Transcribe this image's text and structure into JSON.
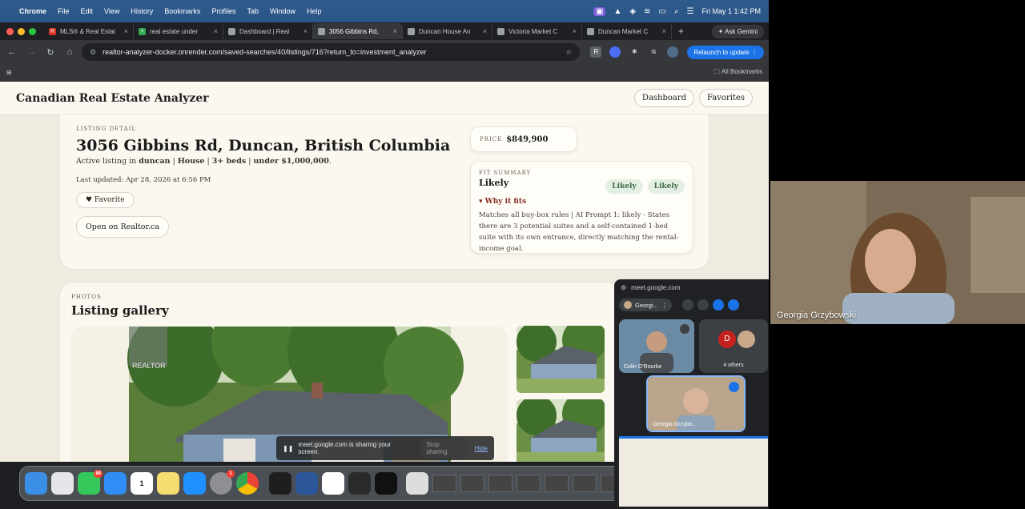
{
  "menubar": {
    "apple_icon": "apple-icon",
    "items": [
      "Chrome",
      "File",
      "Edit",
      "View",
      "History",
      "Bookmarks",
      "Profiles",
      "Tab",
      "Window",
      "Help"
    ],
    "clock": "Fri May 1  1:42 PM"
  },
  "tabs": [
    {
      "title": "MLS® & Real Estat",
      "fav_color": "#d93025",
      "fav_text": "R"
    },
    {
      "title": "real estate under",
      "fav_color": "#34a853",
      "fav_text": "+"
    },
    {
      "title": "Dashboard | Real",
      "fav_color": "#9aa0a6",
      "fav_text": ""
    },
    {
      "title": "3056 Gibbins Rd,",
      "fav_color": "#9aa0a6",
      "fav_text": "",
      "active": true
    },
    {
      "title": "Duncan House An",
      "fav_color": "#9aa0a6",
      "fav_text": ""
    },
    {
      "title": "Victoria Market C",
      "fav_color": "#9aa0a6",
      "fav_text": ""
    },
    {
      "title": "Duncan Market C",
      "fav_color": "#9aa0a6",
      "fav_text": ""
    }
  ],
  "ask_gemini": "Ask Gemini",
  "address_bar": {
    "url": "realtor-analyzer-docker.onrender.com/saved-searches/40/listings/716?return_to=investment_analyzer"
  },
  "relaunch_label": "Relaunch to update",
  "all_bookmarks": "All Bookmarks",
  "app": {
    "brand": "Canadian Real Estate Analyzer",
    "nav": [
      "Dashboard",
      "Favorites"
    ]
  },
  "listing": {
    "eyebrow": "LISTING DETAIL",
    "address": "3056 Gibbins Rd, Duncan, British Columbia",
    "subtitle_prefix": "Active listing in ",
    "city": "duncan",
    "type": "House",
    "beds": "3+ beds",
    "price_cap": "under $1,000,000",
    "updated": "Last updated: Apr 28, 2026 at 6:56 PM",
    "favorite_label": "♥ Favorite",
    "realtor_label": "Open on Realtor.ca",
    "price_label": "PRICE",
    "price": "$849,900",
    "fit_eyebrow": "FIT SUMMARY",
    "fit_value": "Likely",
    "badges": [
      "Likely",
      "Likely"
    ],
    "why_label": "▾ Why it fits",
    "why_text": "Matches all buy-box rules | AI Prompt 1: likely - States there are 3 potential suites and a self-contained 1-bed suite with its own entrance, directly matching the rental-income goal."
  },
  "gallery": {
    "eyebrow": "PHOTOS",
    "title": "Listing gallery",
    "watermark": "REALTOR"
  },
  "share_bar": {
    "text": "meet.google.com is sharing your screen.",
    "stop": "Stop sharing",
    "hide": "Hide"
  },
  "dock": {
    "messages_badge": "88",
    "calendar_day": "1",
    "settings_badge": "1"
  },
  "meet": {
    "url": "meet.google.com",
    "self_label": "Georgi...",
    "tiles": [
      {
        "name": "Colin O'Rourke"
      },
      {
        "name": "4 others",
        "avatar_letter": "D"
      },
      {
        "name": "Georgia Grzybo..."
      }
    ]
  },
  "camera": {
    "name": "Georgia Grzybowski"
  }
}
